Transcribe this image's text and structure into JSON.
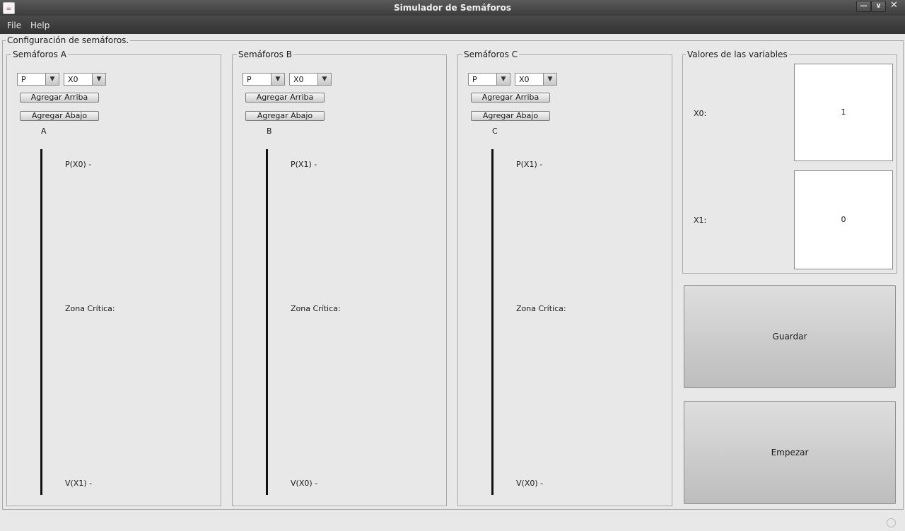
{
  "window": {
    "title": "Simulador de Semáforos",
    "app_icon": "java-icon",
    "minimize": "—",
    "maximize": "∨",
    "close": "✕"
  },
  "menu": {
    "file": "File",
    "help": "Help"
  },
  "config": {
    "legend": "Configuración de semáforos."
  },
  "panels": [
    {
      "legend": "Semáforos A",
      "combo1": "P",
      "combo2": "X0",
      "add_top": "Agregar Arriba",
      "add_bottom": "Agregar Abajo",
      "name": "A",
      "top_op": "P(X0) -",
      "critical": "Zona Crítica:",
      "bottom_op": "V(X1) -"
    },
    {
      "legend": "Semáforos B",
      "combo1": "P",
      "combo2": "X0",
      "add_top": "Agregar Arriba",
      "add_bottom": "Agregar Abajo",
      "name": "B",
      "top_op": "P(X1) -",
      "critical": "Zona Crítica:",
      "bottom_op": "V(X0) -"
    },
    {
      "legend": "Semáforos C",
      "combo1": "P",
      "combo2": "X0",
      "add_top": "Agregar Arriba",
      "add_bottom": "Agregar Abajo",
      "name": "C",
      "top_op": "P(X1) -",
      "critical": "Zona Crítica:",
      "bottom_op": "V(X0) -"
    }
  ],
  "variables": {
    "legend": "Valores de las variables",
    "items": [
      {
        "label": "X0:",
        "value": "1"
      },
      {
        "label": "X1:",
        "value": "0"
      }
    ]
  },
  "actions": {
    "save": "Guardar",
    "start": "Empezar"
  }
}
